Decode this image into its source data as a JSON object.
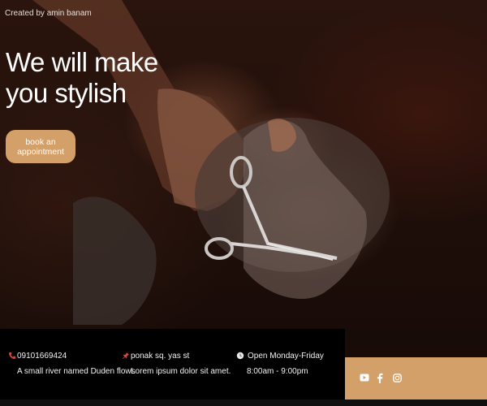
{
  "header": {
    "credit": "Created by amin banam"
  },
  "hero": {
    "headline": "We will make you stylish",
    "cta_label": "book an appointment"
  },
  "info": [
    {
      "icon": "phone-icon",
      "title": "09101669424",
      "text": "A small river named Duden flows"
    },
    {
      "icon": "pin-icon",
      "title": "ponak sq. yas st",
      "text": "Lorem ipsum dolor sit amet."
    },
    {
      "icon": "clock-icon",
      "title": "Open Monday-Friday",
      "text": "8:00am - 9:00pm"
    }
  ],
  "social": [
    "youtube-icon",
    "facebook-icon",
    "instagram-icon"
  ],
  "colors": {
    "accent": "#d4a06a",
    "info_bg": "#000000",
    "phone_icon": "#e0463a",
    "pin_icon": "#e0463a"
  }
}
